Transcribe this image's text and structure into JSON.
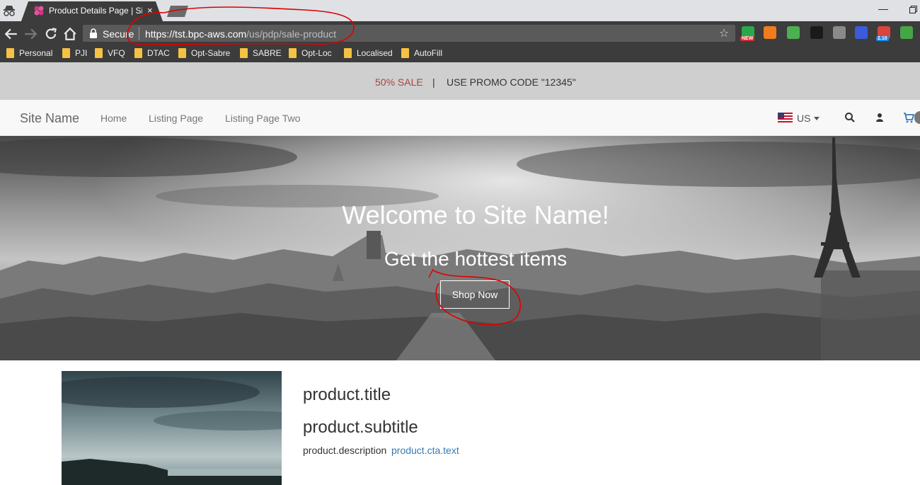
{
  "browser": {
    "tab_title": "Product Details Page | Site",
    "tab_close": "×",
    "secure_label": "Secure",
    "url_host": "https://tst.bpc-aws.com",
    "url_path": "/us/pdp/sale-product",
    "star": "☆",
    "extensions": [
      {
        "name": "ext-new-icon",
        "badge": "NEW",
        "color": "#2aa84a"
      },
      {
        "name": "ext-lifebuoy-icon",
        "badge": "",
        "color": "#f07c1d"
      },
      {
        "name": "ext-tag-icon",
        "badge": "",
        "color": "#4caf50"
      },
      {
        "name": "ext-color-icon",
        "badge": "",
        "color": "#1a1a1a"
      },
      {
        "name": "ext-gray-icon",
        "badge": "",
        "color": "#8a8a8a"
      },
      {
        "name": "ext-gear-icon",
        "badge": "",
        "color": "#3b5bdb"
      },
      {
        "name": "ext-calendar-icon",
        "badge": "2.10",
        "color": "#d9453c"
      },
      {
        "name": "ext-sheet-icon",
        "badge": "",
        "color": "#46a546"
      }
    ],
    "bookmarks": [
      "Personal",
      "PJI",
      "VFQ",
      "DTAC",
      "Opt-Sabre",
      "SABRE",
      "Opt-Loc",
      "Localised",
      "AutoFill"
    ]
  },
  "promo": {
    "sale": "50% SALE",
    "separator": "|",
    "code": "USE PROMO CODE \"12345\""
  },
  "navbar": {
    "brand": "Site Name",
    "links": [
      "Home",
      "Listing Page",
      "Listing Page Two"
    ],
    "locale": "US"
  },
  "hero": {
    "title": "Welcome to Site Name!",
    "subtitle": "Get the hottest items",
    "button": "Shop Now"
  },
  "product": {
    "title": "product.title",
    "subtitle": "product.subtitle",
    "description": "product.description",
    "cta": "product.cta.text"
  },
  "colors": {
    "sale_red": "#a94442",
    "link_blue": "#337ab7",
    "annotation_red": "#e00000"
  }
}
